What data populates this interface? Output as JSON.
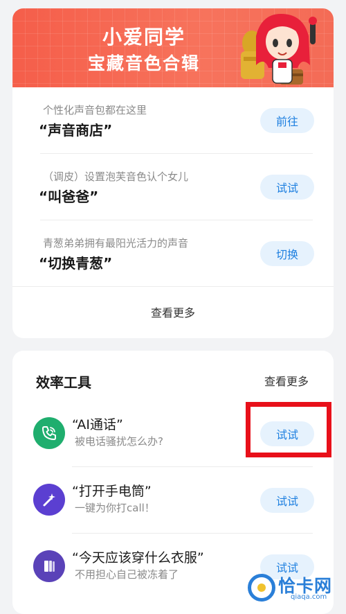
{
  "banner": {
    "title": "小爱同学",
    "subtitle": "宝藏音色合辑"
  },
  "voice_items": [
    {
      "hint": "个性化声音包都在这里",
      "name": "“声音商店”",
      "action": "前往"
    },
    {
      "hint": "（调皮）设置泡芙音色认个女儿",
      "name": "“叫爸爸”",
      "action": "试试"
    },
    {
      "hint": "青葱弟弟拥有最阳光活力的声音",
      "name": "“切换青葱”",
      "action": "切换"
    }
  ],
  "voice_more": "查看更多",
  "tools": {
    "title": "效率工具",
    "more": "查看更多",
    "items": [
      {
        "name": "“AI通话”",
        "desc": "被电话骚扰怎么办?",
        "action": "试试",
        "icon": "phone-icon",
        "color": "#1fae6e"
      },
      {
        "name": "“打开手电筒”",
        "desc": "一键为你打call！",
        "action": "试试",
        "icon": "magic-wand-icon",
        "color": "#5b3fd1"
      },
      {
        "name": "“今天应该穿什么衣服”",
        "desc": "不用担心自己被冻着了",
        "action": "试试",
        "icon": "book-icon",
        "color": "#5a42b8"
      }
    ]
  },
  "watermark": {
    "text": "恰卡网",
    "domain": "qiaqa.com"
  },
  "colors": {
    "accent": "#1d7fe0",
    "pill_bg": "#e6f2fd",
    "banner": "#f55e4a",
    "highlight": "#e8101a"
  }
}
